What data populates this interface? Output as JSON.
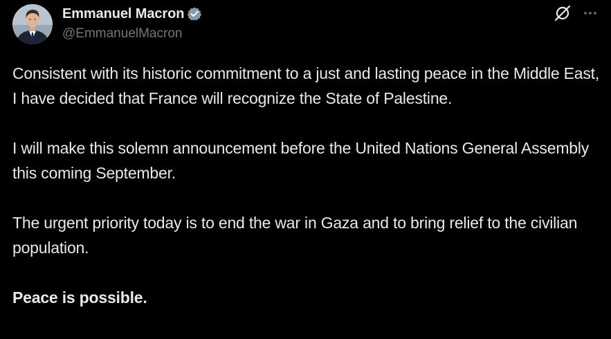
{
  "post": {
    "author": {
      "display_name": "Emmanuel Macron",
      "handle": "@EmmanuelMacron",
      "verified_badge_color": "#829aab",
      "avatar_icon": "profile-photo"
    },
    "actions": {
      "grok_icon": "grok-icon",
      "more_icon": "more-icon"
    },
    "paragraphs": [
      "Consistent with its historic commitment to a just and lasting peace in the Middle East, I have decided that France will recognize the State of Palestine.",
      "I will make this solemn announcement before the United Nations General Assembly this coming September.",
      "The urgent priority today is to end the war in Gaza and to bring relief to the civilian population.",
      "Peace is possible."
    ]
  },
  "colors": {
    "background": "#000000",
    "primary_text": "#e7e9ea",
    "secondary_text": "#71767b"
  }
}
